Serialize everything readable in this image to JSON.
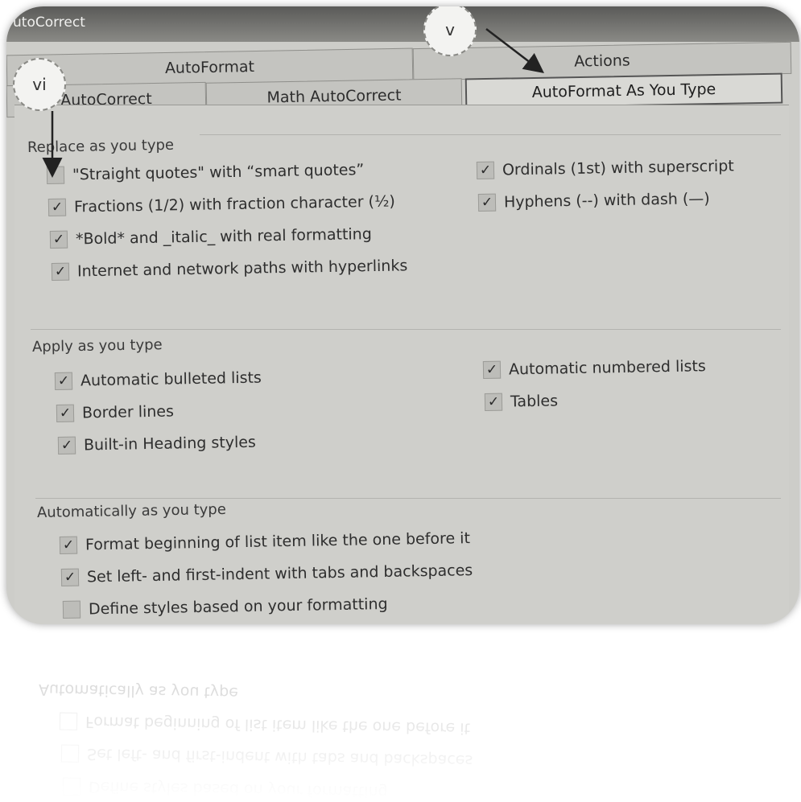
{
  "window": {
    "title_partial": "utoCorrect"
  },
  "tabs": {
    "row1": [
      {
        "label": "AutoFormat"
      },
      {
        "label": "Actions"
      }
    ],
    "row2": [
      {
        "label": "AutoCorrect"
      },
      {
        "label": "Math AutoCorrect"
      },
      {
        "label": "AutoFormat As You Type",
        "active": true
      }
    ]
  },
  "markers": {
    "v": "v",
    "vi": "vi"
  },
  "replace": {
    "label": "Replace as you type",
    "options": [
      {
        "label": "\"Straight quotes\" with “smart quotes”",
        "checked": false
      },
      {
        "label": "Fractions (1/2) with fraction character (½)",
        "checked": true
      },
      {
        "label": "*Bold* and _italic_ with real formatting",
        "checked": true
      },
      {
        "label": "Internet and network paths with hyperlinks",
        "checked": true
      },
      {
        "label": "Ordinals (1st) with superscript",
        "checked": true
      },
      {
        "label": "Hyphens (--) with dash (—)",
        "checked": true
      }
    ]
  },
  "apply": {
    "label": "Apply as you type",
    "options": [
      {
        "label": "Automatic bulleted lists",
        "checked": true
      },
      {
        "label": "Border lines",
        "checked": true
      },
      {
        "label": "Built-in Heading styles",
        "checked": true
      },
      {
        "label": "Automatic numbered lists",
        "checked": true
      },
      {
        "label": "Tables",
        "checked": true
      }
    ]
  },
  "automatically": {
    "label": "Automatically as you type",
    "options": [
      {
        "label": "Format beginning of list item like the one before it",
        "checked": true
      },
      {
        "label": "Set left- and first-indent with tabs and backspaces",
        "checked": true
      },
      {
        "label": "Define styles based on your formatting",
        "checked": false
      }
    ]
  },
  "icons": {
    "check": "checkmark-icon",
    "arrow": "arrow-icon"
  },
  "colors": {
    "background": "#cdcdc9",
    "text": "#2e2e2e"
  }
}
